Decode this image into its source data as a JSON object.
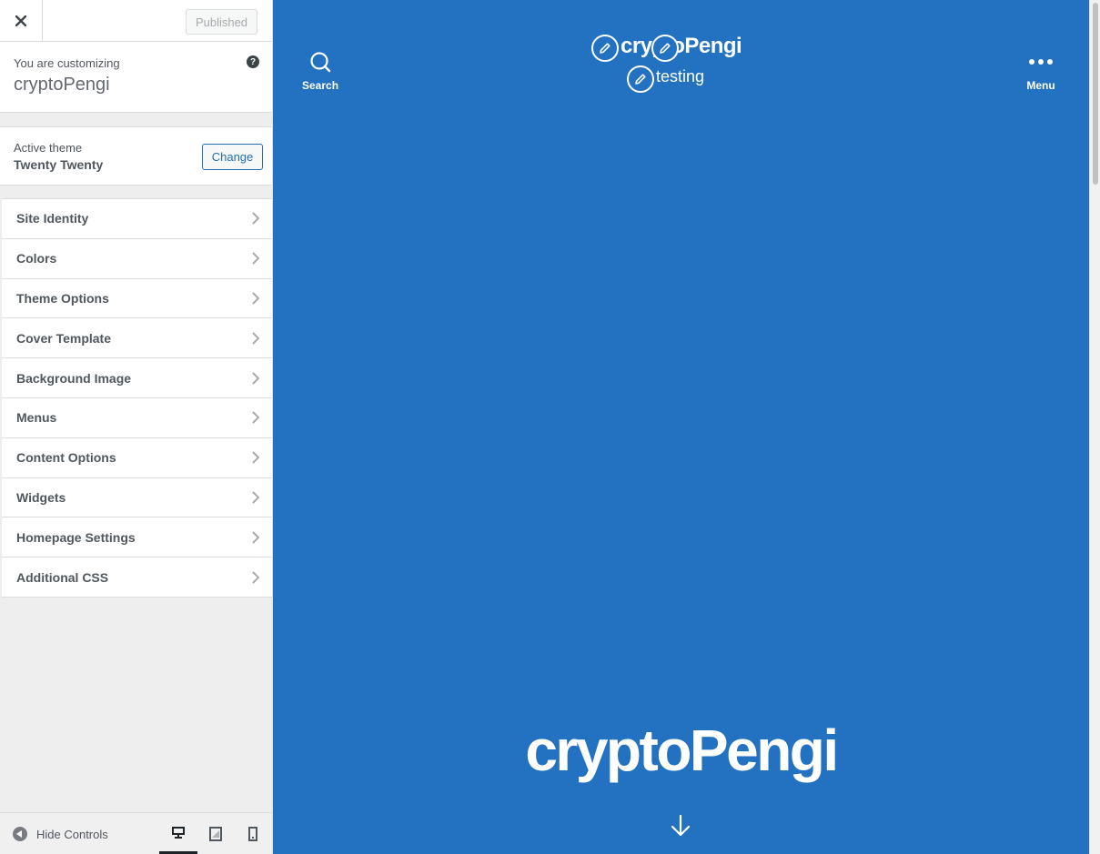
{
  "topbar": {
    "publish_label": "Published"
  },
  "customizing": {
    "intro": "You are customizing",
    "site_name": "cryptoPengi",
    "help": "?"
  },
  "theme": {
    "label": "Active theme",
    "name": "Twenty Twenty",
    "change_label": "Change"
  },
  "panels": [
    {
      "label": "Site Identity"
    },
    {
      "label": "Colors"
    },
    {
      "label": "Theme Options"
    },
    {
      "label": "Cover Template"
    },
    {
      "label": "Background Image"
    },
    {
      "label": "Menus"
    },
    {
      "label": "Content Options"
    },
    {
      "label": "Widgets"
    },
    {
      "label": "Homepage Settings"
    },
    {
      "label": "Additional CSS"
    }
  ],
  "footer": {
    "hide_controls": "Hide Controls",
    "active_device": "desktop"
  },
  "preview": {
    "bg_color": "#2372c2",
    "search_label": "Search",
    "menu_label": "Menu",
    "site_title": "cryptoPengi",
    "tagline": "testing",
    "cover_title": "cryptoPengi"
  }
}
